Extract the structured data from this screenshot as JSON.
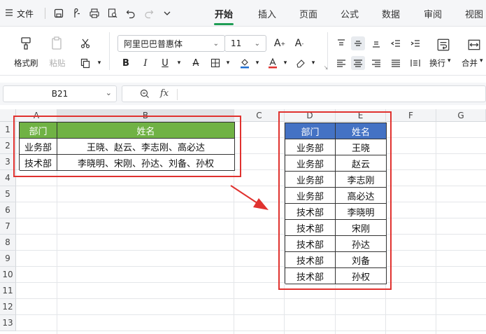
{
  "menubar": {
    "file_label": "文件",
    "tabs": [
      "开始",
      "插入",
      "页面",
      "公式",
      "数据",
      "审阅",
      "视图"
    ],
    "active_tab": "开始"
  },
  "ribbon": {
    "format_painter": "格式刷",
    "paste": "粘贴",
    "font_name": "阿里巴巴普惠体",
    "font_size": "11",
    "wrap": "换行",
    "merge": "合并"
  },
  "formula_bar": {
    "cell_ref": "B21",
    "fx": "fx",
    "content": ""
  },
  "sheet": {
    "columns": [
      "A",
      "B",
      "C",
      "D",
      "E",
      "F",
      "G"
    ],
    "rows": [
      "1",
      "2",
      "3",
      "4",
      "5",
      "6",
      "7",
      "8",
      "9",
      "10",
      "11",
      "12",
      "13"
    ],
    "table1": {
      "headers": [
        "部门",
        "姓名"
      ],
      "rows": [
        [
          "业务部",
          "王晓、赵云、李志刚、高必达"
        ],
        [
          "技术部",
          "李晓明、宋刚、孙达、刘备、孙权"
        ]
      ]
    },
    "table2": {
      "headers": [
        "部门",
        "姓名"
      ],
      "rows": [
        [
          "业务部",
          "王晓"
        ],
        [
          "业务部",
          "赵云"
        ],
        [
          "业务部",
          "李志刚"
        ],
        [
          "业务部",
          "高必达"
        ],
        [
          "技术部",
          "李晓明"
        ],
        [
          "技术部",
          "宋刚"
        ],
        [
          "技术部",
          "孙达"
        ],
        [
          "技术部",
          "刘备"
        ],
        [
          "技术部",
          "孙权"
        ]
      ]
    }
  },
  "colors": {
    "accent": "#1f9d55",
    "header_green": "#70b244",
    "header_blue": "#4472c4",
    "highlight_red": "#e0322f"
  }
}
